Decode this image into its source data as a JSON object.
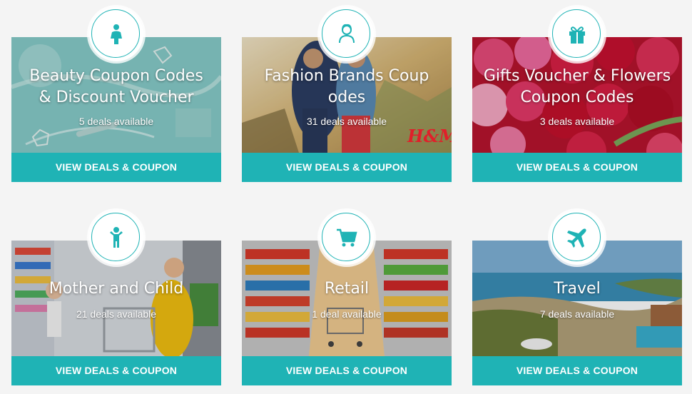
{
  "colors": {
    "accent": "#1fb3b5",
    "background": "#f4f4f4",
    "text_on_image": "#ffffff"
  },
  "cards": [
    {
      "title": "Beauty Coupon Codes & Discount Voucher",
      "title_line1": "Beauty Coupon Codes",
      "title_line2": "& Discount Voucher",
      "deals": "5 deals available",
      "button": "VIEW DEALS & COUPON",
      "icon": "woman-icon"
    },
    {
      "title": "Fashion Brands Coupon Codes",
      "title_line1": "Fashion Brands Coup",
      "title_line2": "odes",
      "deals": "31 deals available",
      "button": "VIEW DEALS & COUPON",
      "icon": "user-icon"
    },
    {
      "title": "Gifts Voucher & Flowers Coupon Codes",
      "title_line1": "Gifts Voucher & Flowers",
      "title_line2": "Coupon Codes",
      "deals": "3 deals available",
      "button": "VIEW DEALS & COUPON",
      "icon": "gift-icon"
    },
    {
      "title": "Mother and Child",
      "deals": "21 deals available",
      "button": "VIEW DEALS & COUPON",
      "icon": "child-icon"
    },
    {
      "title": "Retail",
      "deals": "1 deal available",
      "button": "VIEW DEALS & COUPON",
      "icon": "cart-icon"
    },
    {
      "title": "Travel",
      "deals": "7 deals available",
      "button": "VIEW DEALS & COUPON",
      "icon": "plane-icon"
    }
  ],
  "images": {
    "fashion_logo": "H&M"
  }
}
